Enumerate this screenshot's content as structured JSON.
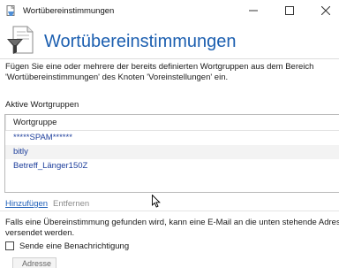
{
  "window": {
    "title": "Wortübereinstimmungen"
  },
  "page": {
    "title": "Wortübereinstimmungen",
    "description_line1": "Fügen Sie eine oder mehrere der bereits definierten Wortgruppen aus dem Bereich",
    "description_line2": "'Wortübereinstimmungen' des Knoten 'Voreinstellungen' ein."
  },
  "active_groups": {
    "label": "Aktive Wortgruppen",
    "column_header": "Wortgruppe",
    "rows": [
      {
        "name": "*****SPAM******"
      },
      {
        "name": "bitly"
      },
      {
        "name": "Betreff_Länger150Z"
      }
    ],
    "add_label": "Hinzufügen",
    "remove_label": "Entfernen"
  },
  "notification": {
    "info_line1": "Falls eine Übereinstimmung gefunden wird, kann eine E-Mail an die unten stehende Adresse",
    "info_line2": "versendet werden.",
    "checkbox_label": "Sende eine Benachrichtigung",
    "checked": false,
    "address_label": "Adresse"
  },
  "colors": {
    "accent": "#1c5fb0",
    "link": "#1f5fb8",
    "row_text": "#1e3f9c"
  }
}
